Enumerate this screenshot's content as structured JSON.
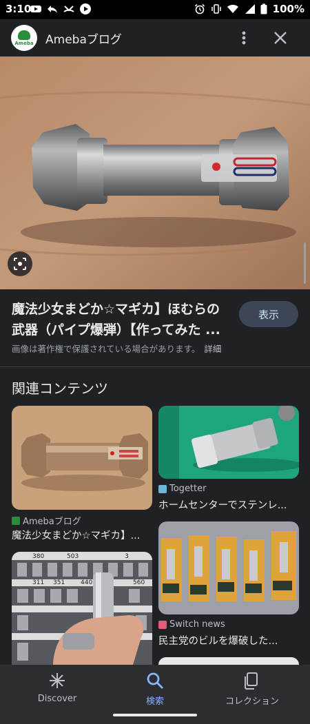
{
  "status_bar": {
    "time": "3:10",
    "battery": "100%"
  },
  "header": {
    "site_name": "Amebaブログ",
    "logo_text": "Ameba"
  },
  "result": {
    "title_line1": "魔法少女まどか☆マギカ】ほむらの",
    "title_line2": "武器（パイプ爆弾）【作ってみた ...",
    "show_button": "表示",
    "copyright_note": "画像は著作権で保護されている場合があります。",
    "details_link": "詳細"
  },
  "related": {
    "heading": "関連コンテンツ",
    "cards": [
      {
        "source": "Amebaブログ",
        "title": "魔法少女まどか☆マギカ】..."
      },
      {
        "source": "Togetter",
        "title": "ホームセンターでステンレ..."
      },
      {
        "source": "Switch news",
        "title": "民主党のビルを爆破した..."
      }
    ],
    "price_tags": [
      "380",
      "503",
      "3",
      "311",
      "351",
      "440",
      "560"
    ]
  },
  "bottom_nav": {
    "items": [
      {
        "label": "Discover",
        "icon": "asterisk-icon"
      },
      {
        "label": "検索",
        "icon": "search-icon"
      },
      {
        "label": "コレクション",
        "icon": "collections-icon"
      }
    ],
    "active_index": 1
  },
  "colors": {
    "accent": "#8ab4f8",
    "background": "#1f2124",
    "button_bg": "#3c4656"
  }
}
